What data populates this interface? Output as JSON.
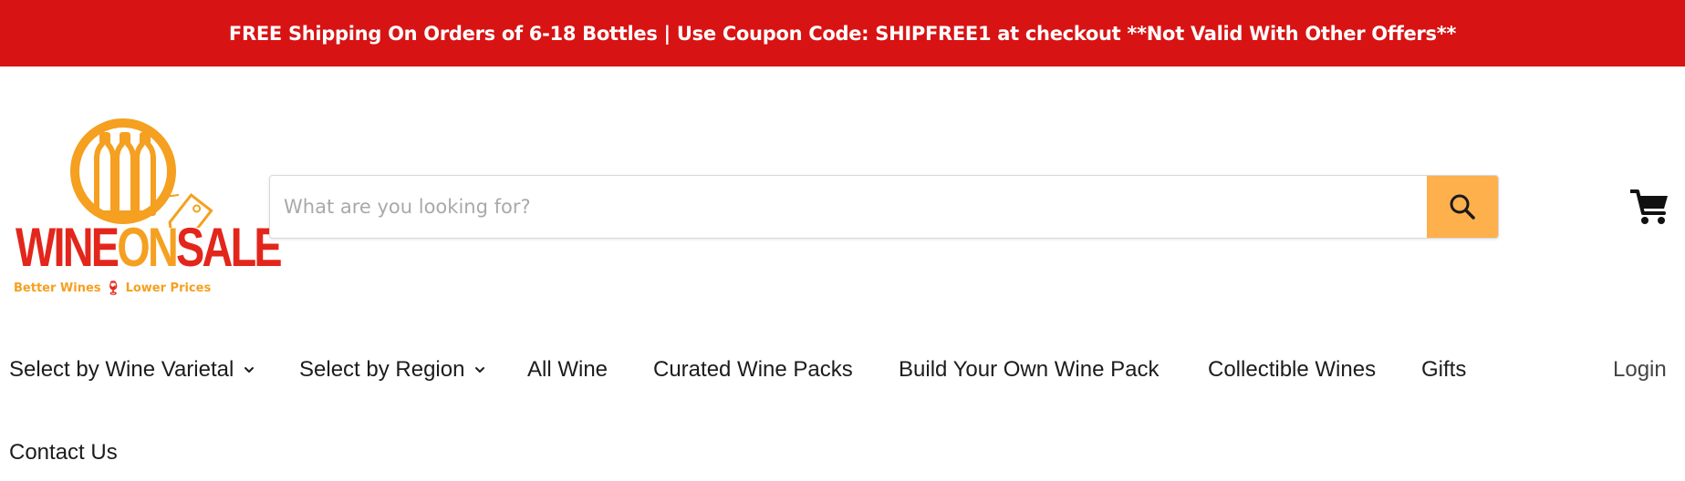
{
  "announcement": {
    "text": "FREE Shipping On Orders of 6-18 Bottles | Use Coupon Code: SHIPFREE1 at checkout **Not Valid With Other Offers**"
  },
  "logo": {
    "word_part1": "WINE",
    "word_part2": "ON",
    "word_part3": "SALE",
    "tagline_left": "Better Wines",
    "tagline_right": "Lower Prices"
  },
  "search": {
    "placeholder": "What are you looking for?",
    "value": ""
  },
  "nav": {
    "items": [
      {
        "label": "Select by Wine Varietal",
        "dropdown": true
      },
      {
        "label": "Select by Region",
        "dropdown": true
      },
      {
        "label": "All Wine"
      },
      {
        "label": "Curated Wine Packs"
      },
      {
        "label": "Build Your Own Wine Pack"
      },
      {
        "label": "Collectible Wines"
      },
      {
        "label": "Gifts"
      }
    ],
    "login": "Login",
    "contact": "Contact Us"
  },
  "colors": {
    "announcement_bg": "#d81313",
    "logo_red": "#e3261c",
    "logo_orange": "#f5a020",
    "search_button": "#fdb04c"
  },
  "icons": {
    "search": "magnifier-icon",
    "cart": "shopping-cart-icon",
    "dropdown": "chevron-down-icon",
    "logo_mark": "wine-bottles-ring-with-tag",
    "tagline_divider": "wine-glass-icon"
  }
}
